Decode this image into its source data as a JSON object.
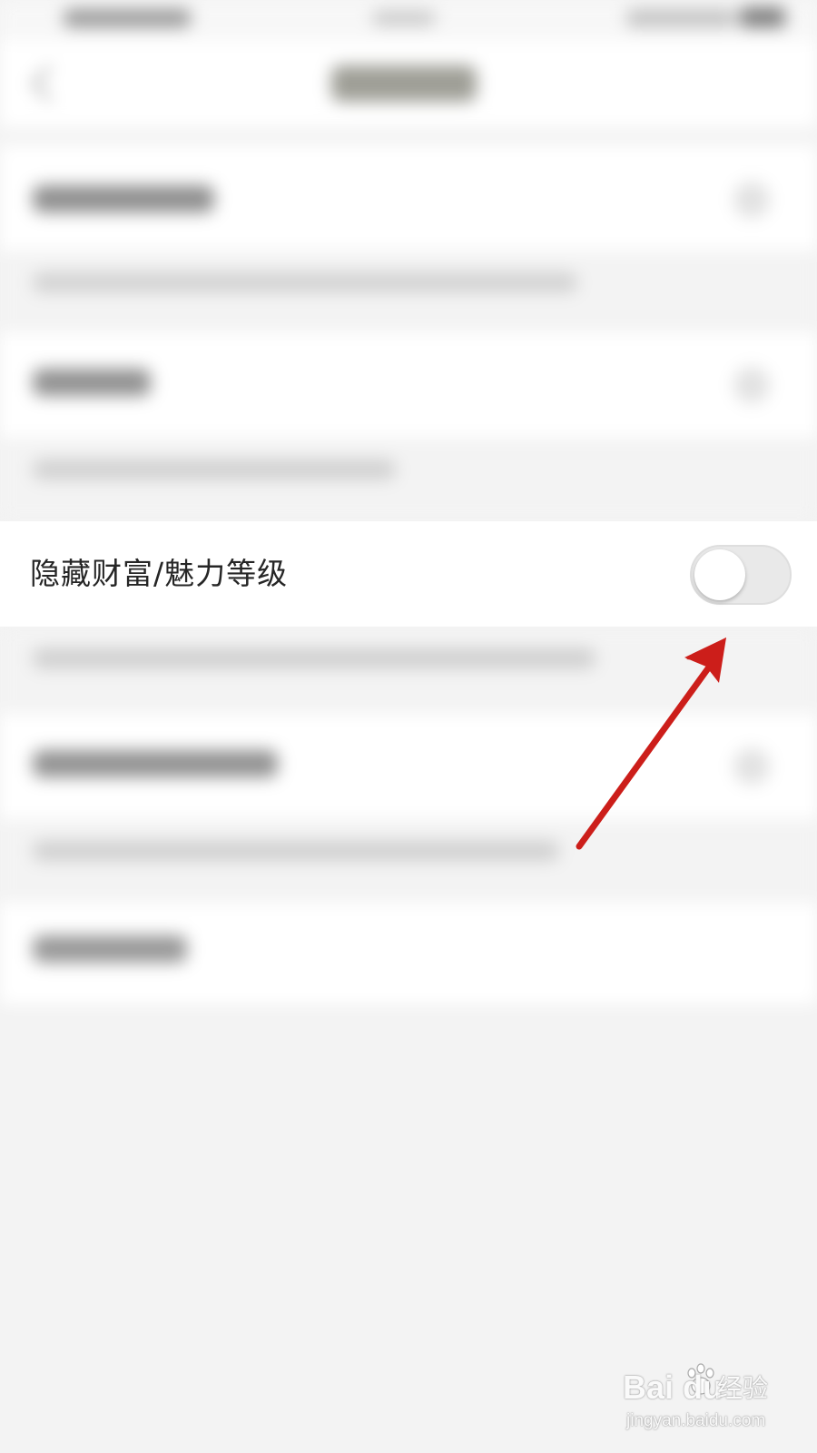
{
  "settings_row": {
    "label": "隐藏财富/魅力等级",
    "toggle_on": false
  },
  "watermark": {
    "logo": "Bai du",
    "brand": "经验",
    "url": "jingyan.baidu.com"
  },
  "colors": {
    "arrow": "#cc1e1a",
    "toggle_off_track": "#e9e9e9",
    "page_background": "#f3f3f3"
  },
  "icons": {
    "back": "chevron-left-icon",
    "annotation": "red-arrow",
    "watermark_mark": "paw-icon"
  }
}
